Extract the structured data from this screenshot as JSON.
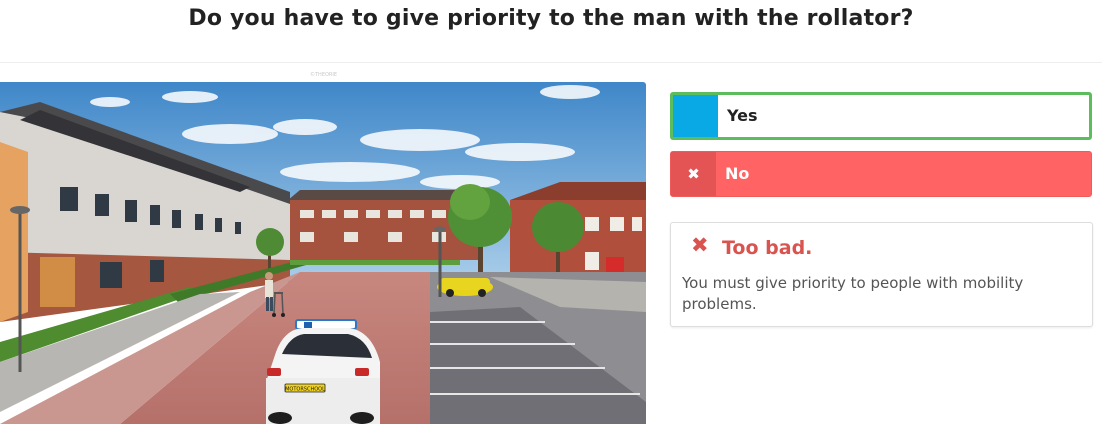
{
  "question": {
    "text": "Do you have to give priority to the man with the rollator?"
  },
  "scene": {
    "watermark": "©THEORIE",
    "license_plate": "MOTORSCHOOL"
  },
  "answers": [
    {
      "label": "Yes",
      "marker_color": "#08a9e5",
      "state": "selected-correct"
    },
    {
      "label": "No",
      "marker_icon": "✖",
      "state": "wrong",
      "color": "#ff6363"
    }
  ],
  "feedback": {
    "icon": "✖",
    "title": "Too bad.",
    "text": "You must give priority to people with mobility problems.",
    "color": "#d9534f"
  }
}
